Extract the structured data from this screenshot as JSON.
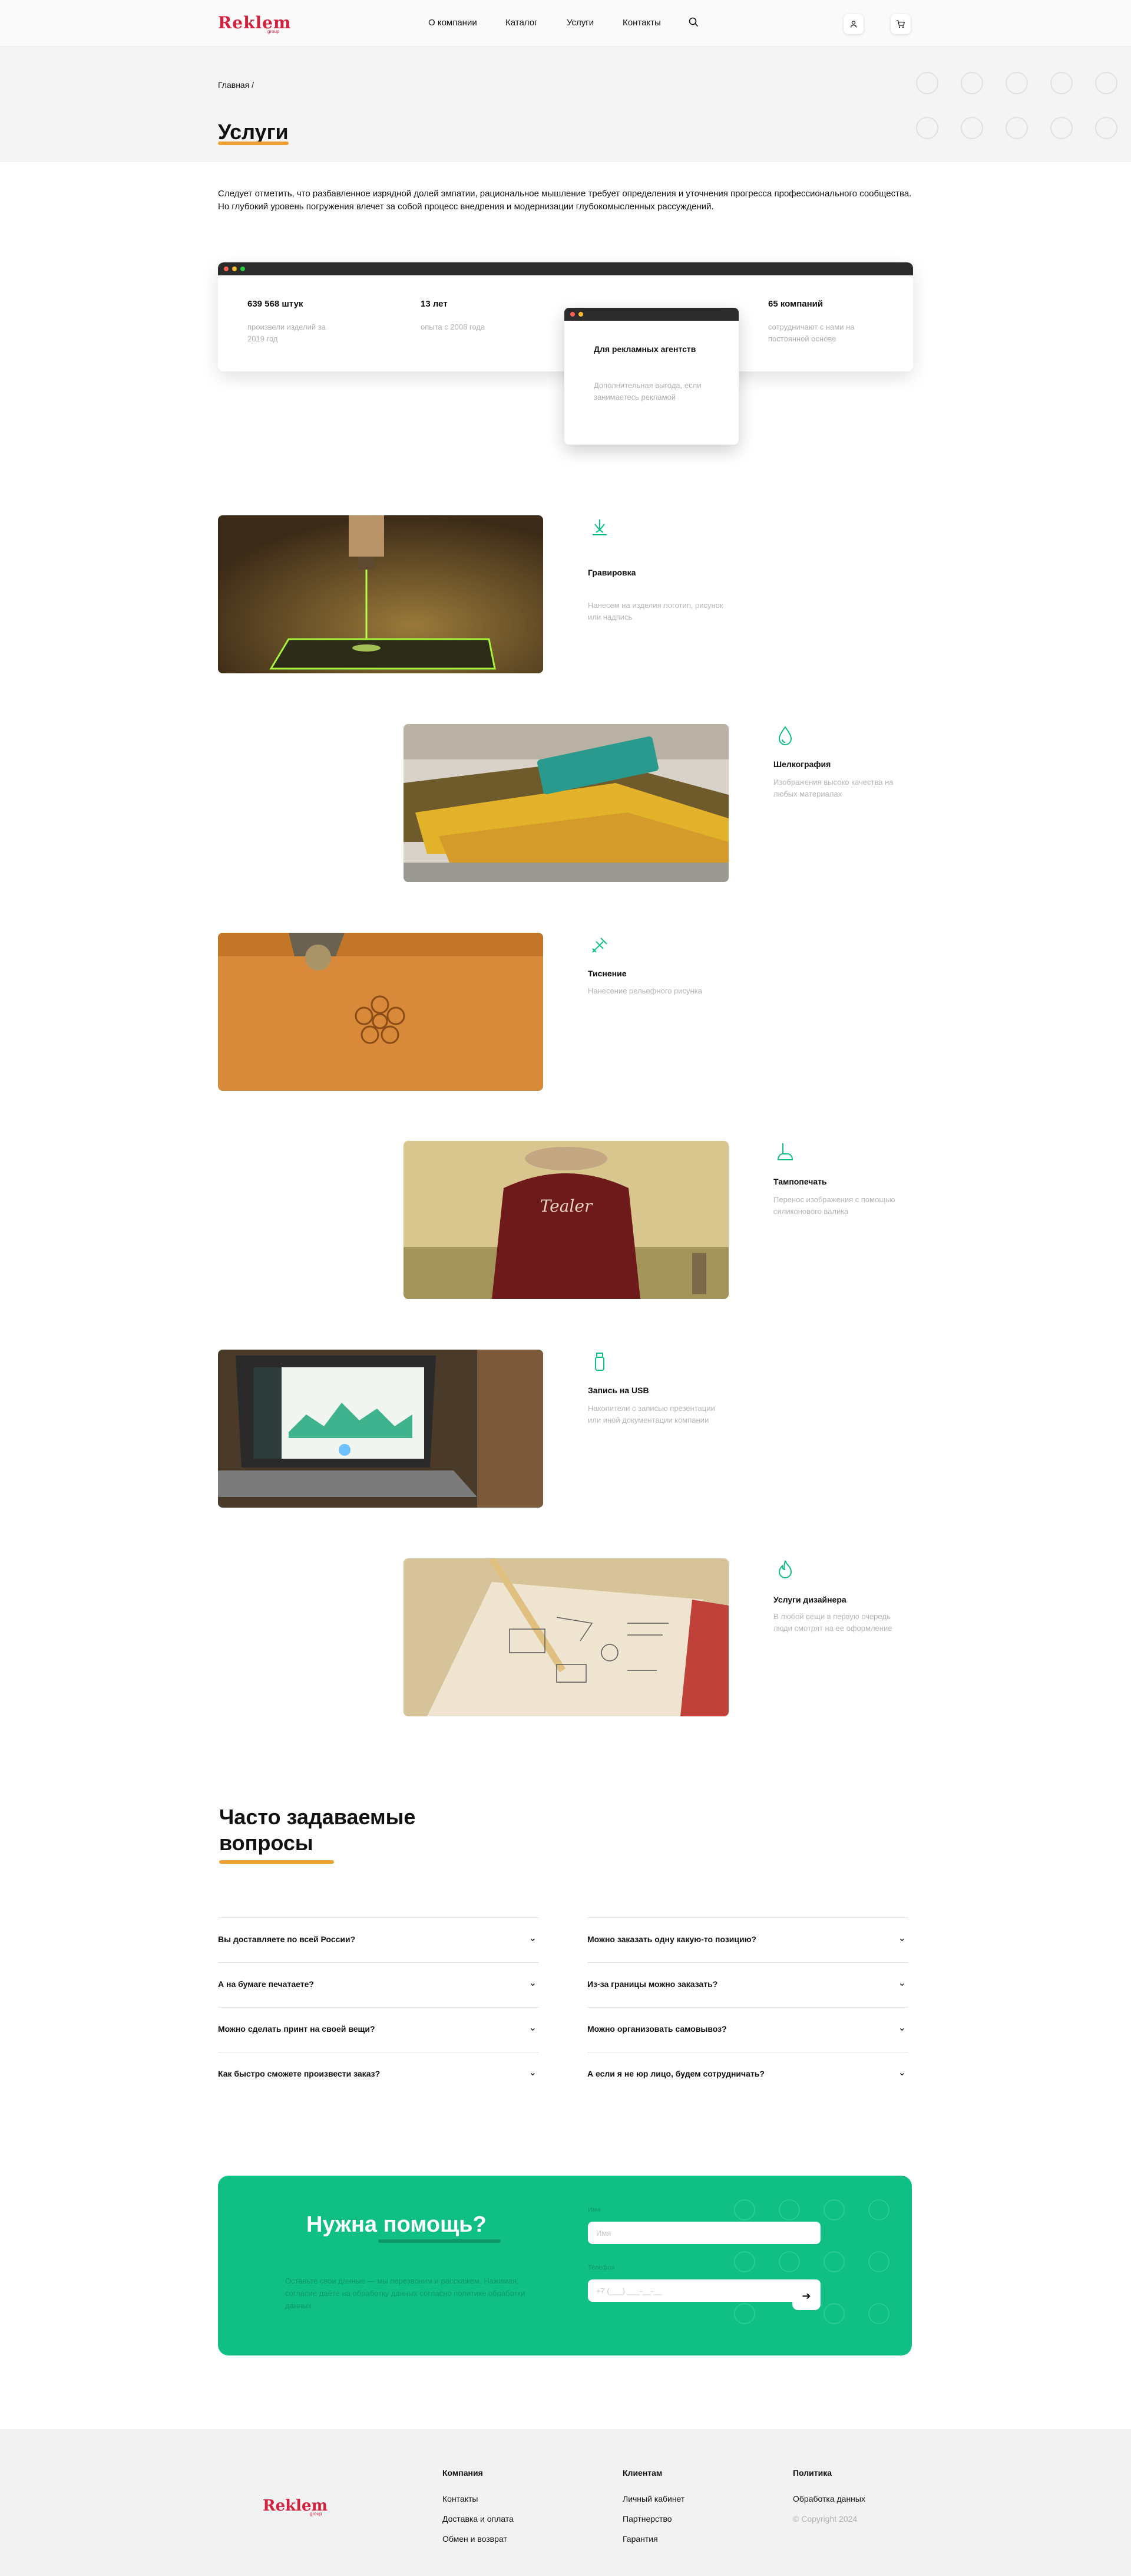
{
  "header": {
    "logo": "Reklem",
    "logo_sub": "group",
    "nav": [
      "О компании",
      "Каталог",
      "Услуги",
      "Контакты"
    ],
    "icons": [
      "search-icon",
      "user-icon",
      "cart-icon"
    ]
  },
  "hero": {
    "breadcrumb": "Главная   /",
    "title": "Услуги"
  },
  "intro": "Следует отметить, что разбавленное изрядной долей эмпатии, рациональное мышление требует определения и уточнения прогресса профессионального сообщества. Но глубокий уровень погружения влечет за собой процесс внедрения и модернизации глубокомысленных рассуждений.",
  "stats": [
    {
      "value": "639 568 штук",
      "label": "произвели изделий за 2019 год"
    },
    {
      "value": "13 лет",
      "label": "опыта с 2008 года"
    },
    {
      "value": "65 компаний",
      "label": "сотрудничают с нами на постоянной основе"
    }
  ],
  "popup": {
    "title": "Для рекламных агентств",
    "text": "Дополнительная выгода, если занимаетесь рекламой"
  },
  "services": [
    {
      "title": "Гравировка",
      "desc": "Нанесем на изделия логотип, рисунок или надпись",
      "icon": "laser-icon"
    },
    {
      "title": "Шелкография",
      "desc": "Изображения высоко качества на любых материалах",
      "icon": "ink-drop-icon"
    },
    {
      "title": "Тиснение",
      "desc": "Нанесение рельефного рисунка",
      "icon": "stamp-tools-icon"
    },
    {
      "title": "Тампопечать",
      "desc": "Перенос изображения с помощью силиконового валика",
      "icon": "tampo-icon"
    },
    {
      "title": "Запись на USB",
      "desc": "Накопители с записью презентации или иной документации компании",
      "icon": "usb-icon"
    },
    {
      "title": "Услуги дизайнера",
      "desc": "В любой вещи в первую очередь люди смотрят на ее оформление",
      "icon": "flame-icon"
    }
  ],
  "faq": {
    "title": "Часто задаваемые вопросы",
    "left": [
      "Вы доставляете по всей России?",
      "А на бумаге печатаете?",
      "Можно сделать принт на своей вещи?",
      "Как быстро сможете произвести заказ?"
    ],
    "right": [
      "Можно заказать одну какую-то позицию?",
      "Из-за границы можно заказать?",
      "Можно организовать самовывоз?",
      "А если я не юр лицо, будем сотрудничать?"
    ]
  },
  "help": {
    "title": "Нужна помощь?",
    "note": "Оставьте свои данные — мы перезвоним и расскажем. Нажимая, согласие даёте на обработку данных согласно политике обработки данных",
    "name_label": "Имя",
    "name_placeholder": "Имя",
    "phone_label": "Телефон",
    "phone_placeholder": "+7 (___) ___-__-__",
    "send_icon": "arrow-right-icon"
  },
  "footer": {
    "logo": "Reklem",
    "logo_sub": "group",
    "company": {
      "title": "Компания",
      "links": [
        "Контакты",
        "Доставка и оплата",
        "Обмен и возврат"
      ]
    },
    "clients": {
      "title": "Клиентам",
      "links": [
        "Личный кабинет",
        "Партнерство",
        "Гарантия"
      ]
    },
    "policy": {
      "title": "Политика",
      "links": [
        "Обработка данных"
      ],
      "copyright": "© Copyright 2024"
    }
  },
  "colors": {
    "brand": "#d4203f",
    "accent": "#10bf84",
    "underline": "#f0a030"
  }
}
